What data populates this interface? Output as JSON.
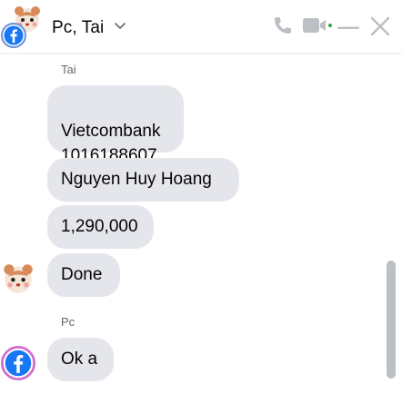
{
  "header": {
    "title": "Pc, Tai",
    "icons": [
      "phone-icon",
      "video-camera-icon",
      "minimize-icon",
      "close-icon"
    ],
    "accent_color": "#bcc0c4"
  },
  "conversation": {
    "groups": [
      {
        "sender": "Tai",
        "messages": [
          "Vietcombank\n1016188607",
          "Nguyen Huy Hoang",
          "1,290,000",
          "Done"
        ]
      },
      {
        "sender": "Pc",
        "messages": [
          "Ok a"
        ]
      }
    ],
    "bubble_color": "#e4e6eb"
  }
}
